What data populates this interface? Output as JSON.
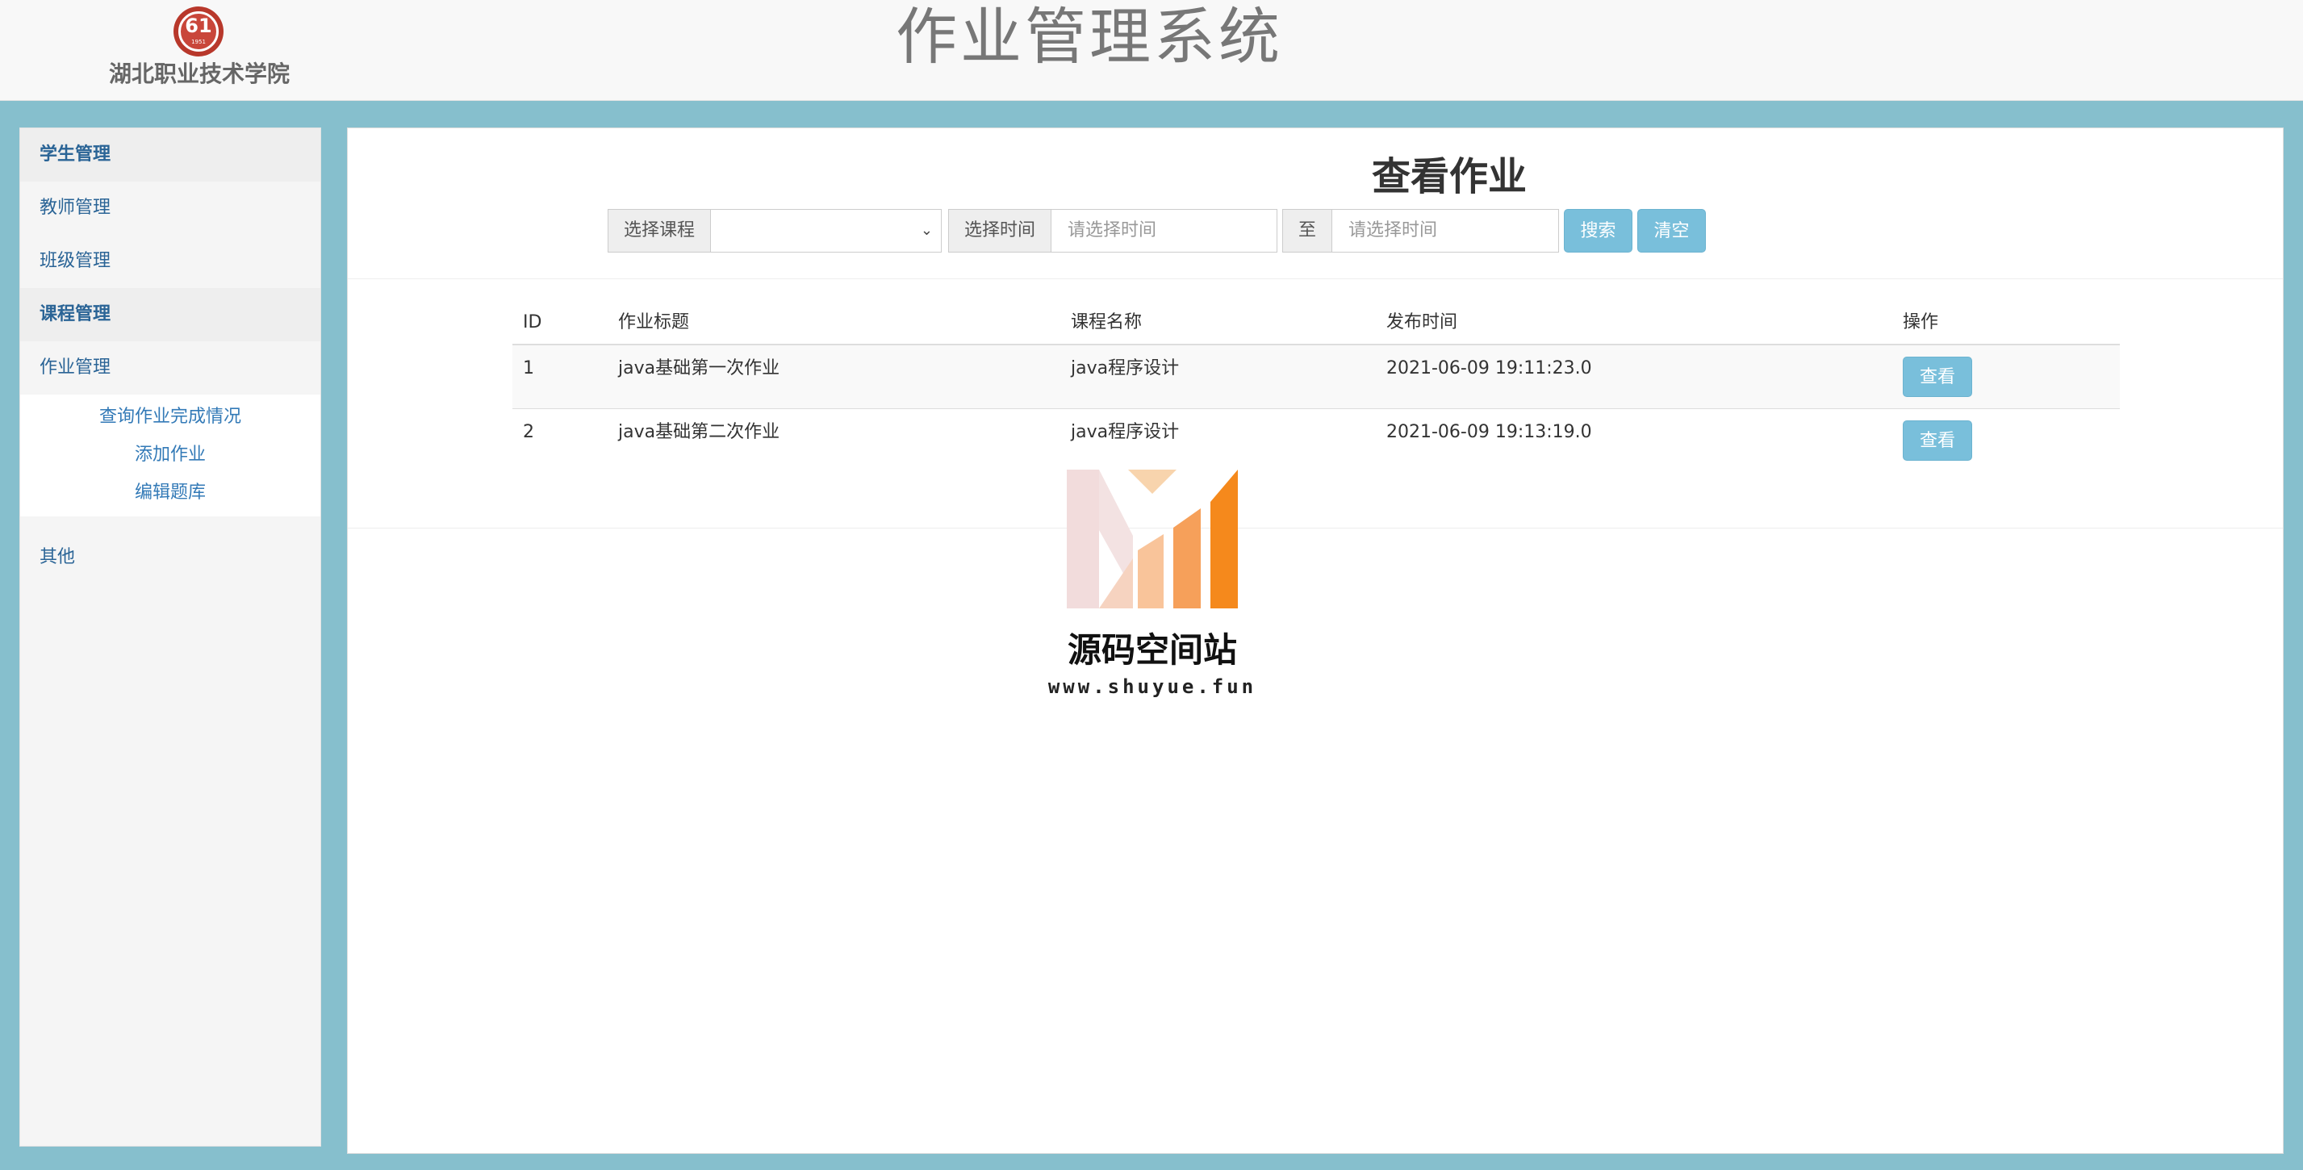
{
  "header": {
    "logo_mark": "61",
    "logo_year": "1951",
    "school_name": "湖北职业技术学院",
    "site_title": "作业管理系统"
  },
  "sidebar": {
    "items": [
      {
        "label": "学生管理"
      },
      {
        "label": "教师管理"
      },
      {
        "label": "班级管理"
      },
      {
        "label": "课程管理"
      },
      {
        "label": "作业管理"
      },
      {
        "label": "其他"
      }
    ],
    "homework_submenu": [
      {
        "label": "查询作业完成情况"
      },
      {
        "label": "添加作业"
      },
      {
        "label": "编辑题库"
      }
    ]
  },
  "main": {
    "title": "查看作业",
    "search": {
      "course_label": "选择课程",
      "course_value": "",
      "time_label": "选择时间",
      "start_placeholder": "请选择时间",
      "to_label": "至",
      "end_placeholder": "请选择时间",
      "search_button": "搜索",
      "clear_button": "清空"
    },
    "table": {
      "columns": [
        "ID",
        "作业标题",
        "课程名称",
        "发布时间",
        "操作"
      ],
      "rows": [
        {
          "id": "1",
          "title": "java基础第一次作业",
          "course": "java程序设计",
          "time": "2021-06-09 19:11:23.0",
          "action": "查看"
        },
        {
          "id": "2",
          "title": "java基础第二次作业",
          "course": "java程序设计",
          "time": "2021-06-09 19:13:19.0",
          "action": "查看"
        }
      ]
    }
  },
  "watermark": {
    "title": "源码空间站",
    "url": "www.shuyue.fun"
  },
  "colors": {
    "page_background": "#86bfcd",
    "button": "#79bfdb",
    "link": "#337ab7"
  },
  "icons": {
    "course_select": "chevron-down-icon",
    "school_logo": "school-emblem-icon",
    "watermark_logo": "bar-chart-m-logo"
  }
}
